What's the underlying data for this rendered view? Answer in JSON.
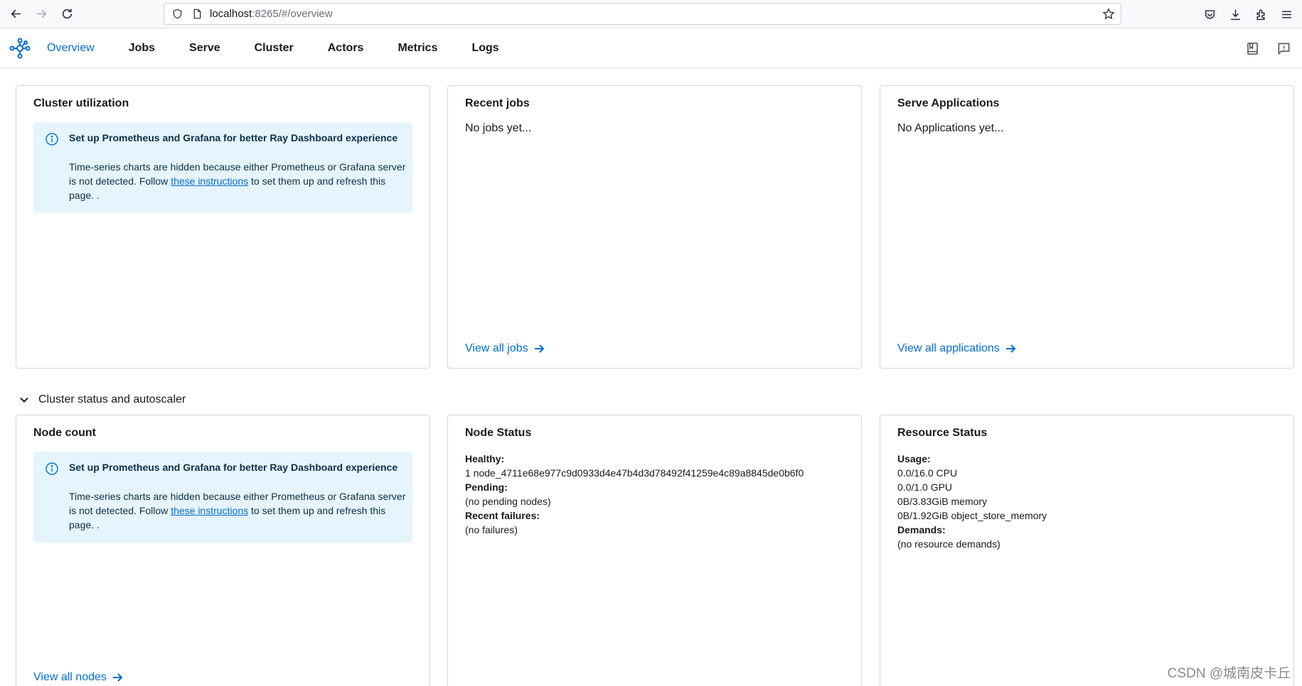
{
  "browser": {
    "url_host": "localhost",
    "url_rest": ":8265/#/overview"
  },
  "nav": {
    "tabs": [
      "Overview",
      "Jobs",
      "Serve",
      "Cluster",
      "Actors",
      "Metrics",
      "Logs"
    ],
    "active": "Overview"
  },
  "alert": {
    "title": "Set up Prometheus and Grafana for better Ray Dashboard experience",
    "body_before": "Time-series charts are hidden because either Prometheus or Grafana server is not detected. Follow ",
    "link_text": "these instructions",
    "body_after": " to set them up and refresh this page. ."
  },
  "cluster_utilization": {
    "title": "Cluster utilization"
  },
  "recent_jobs": {
    "title": "Recent jobs",
    "empty": "No jobs yet...",
    "link": "View all jobs"
  },
  "serve_apps": {
    "title": "Serve Applications",
    "empty": "No Applications yet...",
    "link": "View all applications"
  },
  "section": {
    "label": "Cluster status and autoscaler"
  },
  "node_count": {
    "title": "Node count",
    "link": "View all nodes"
  },
  "node_status": {
    "title": "Node Status",
    "healthy_label": "Healthy:",
    "healthy_value": "1 node_4711e68e977c9d0933d4e47b4d3d78492f41259e4c89a8845de0b6f0",
    "pending_label": "Pending:",
    "pending_value": "(no pending nodes)",
    "failures_label": "Recent failures:",
    "failures_value": "(no failures)"
  },
  "resource_status": {
    "title": "Resource Status",
    "usage_label": "Usage:",
    "usage": [
      "0.0/16.0 CPU",
      "0.0/1.0 GPU",
      "0B/3.83GiB memory",
      "0B/1.92GiB object_store_memory"
    ],
    "demands_label": "Demands:",
    "demands_value": "(no resource demands)"
  },
  "watermark": "CSDN @城南皮卡丘",
  "colors": {
    "accent": "#036dcf",
    "alert_bg": "#e5f4fd",
    "alert_text": "#0e3048"
  }
}
